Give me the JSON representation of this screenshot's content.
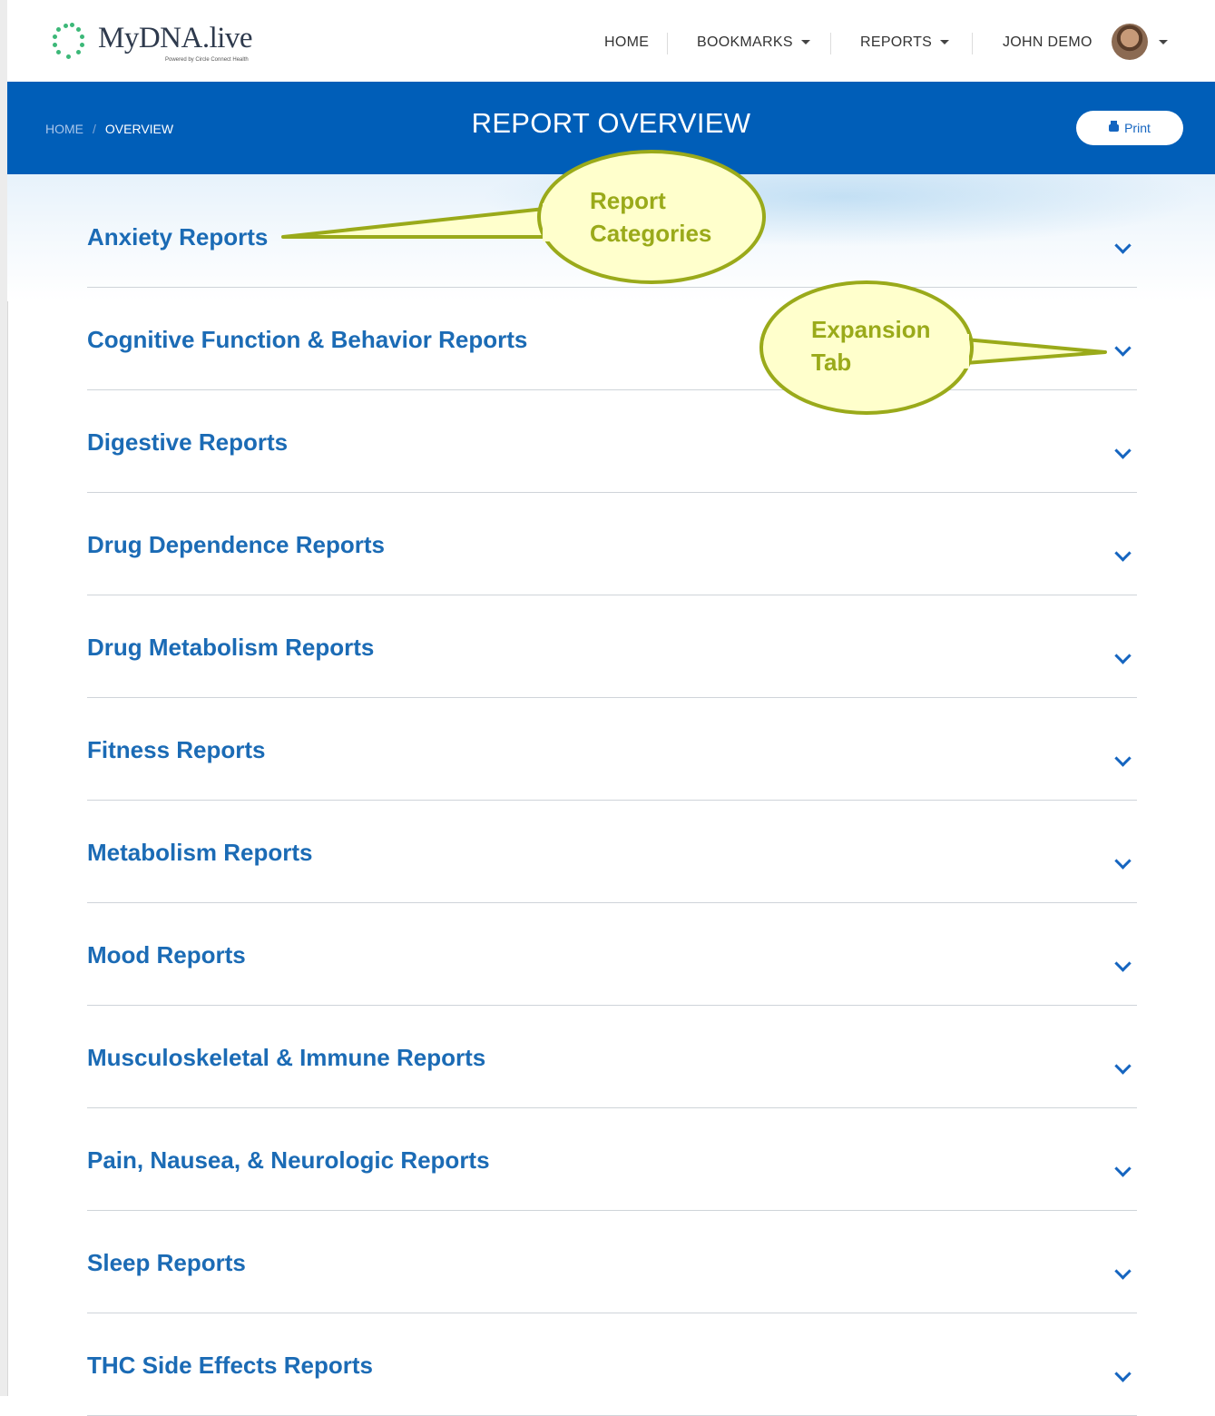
{
  "logo": {
    "name": "MyDNA.live",
    "tagline": "Powered by Circle Connect Health"
  },
  "nav": {
    "home": "HOME",
    "bookmarks": "BOOKMARKS",
    "reports": "REPORTS",
    "user": "JOHN DEMO"
  },
  "header": {
    "breadcrumb_home": "HOME",
    "breadcrumb_separator": "/",
    "breadcrumb_current": "OVERVIEW",
    "title": "REPORT OVERVIEW",
    "print_label": "Print"
  },
  "categories": [
    "Anxiety Reports",
    "Cognitive Function & Behavior Reports",
    "Digestive Reports",
    "Drug Dependence Reports",
    "Drug Metabolism Reports",
    "Fitness Reports",
    "Metabolism Reports",
    "Mood Reports",
    "Musculoskeletal & Immune Reports",
    "Pain, Nausea, & Neurologic Reports",
    "Sleep Reports",
    "THC Side Effects Reports"
  ],
  "callouts": {
    "report_categories_line1": "Report",
    "report_categories_line2": "Categories",
    "expansion_tab_line1": "Expansion",
    "expansion_tab_line2": "Tab"
  },
  "colors": {
    "brand_blue": "#005eb8",
    "link_blue": "#1b6bb5",
    "callout_fill": "#ffffcc",
    "callout_stroke": "#9aaa1a",
    "logo_green": "#3cb878"
  },
  "icons": [
    "chevron-down-icon",
    "printer-icon",
    "caret-down-icon",
    "avatar"
  ]
}
